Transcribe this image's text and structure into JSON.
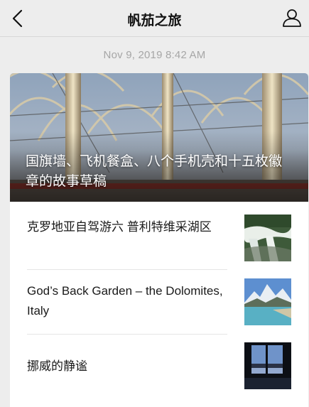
{
  "nav": {
    "title": "帆茄之旅",
    "back_icon": "chevron-left-icon",
    "profile_icon": "person-icon"
  },
  "timestamp": "Nov 9, 2019 8:42 AM",
  "feature": {
    "title": "国旗墙、飞机餐盒、八个手机壳和十五枚徽章的故事草稿"
  },
  "articles": [
    {
      "title": "克罗地亚自驾游六  普利特维采湖区"
    },
    {
      "title": "God’s Back Garden – the Dolomites, Italy"
    },
    {
      "title": "挪威的静谧"
    }
  ]
}
